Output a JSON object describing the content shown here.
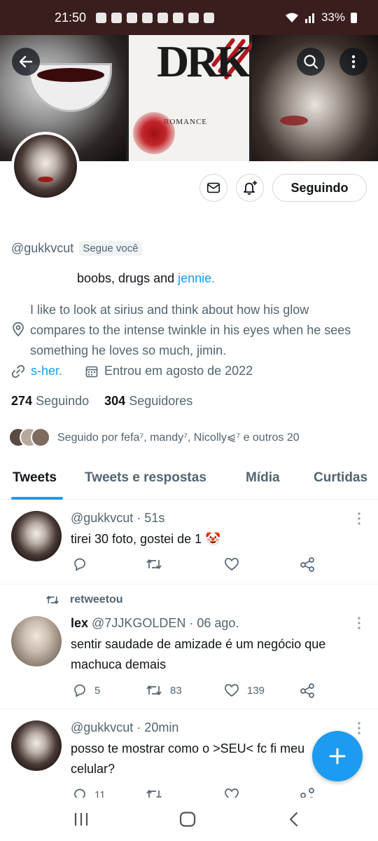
{
  "status_bar": {
    "time": "21:50",
    "battery": "33%"
  },
  "profile": {
    "handle": "@gukkvcut",
    "follows_you": "Segue você",
    "follow_button": "Seguindo",
    "bio_line1_text": "boobs, drugs and ",
    "bio_line1_link": "jennie.",
    "bio_location": "I like to look at sirius and think about how his glow compares to the intense twinkle in his eyes when he sees something he loves so much, jimin.",
    "url": "s-her.",
    "joined": "Entrou em agosto de 2022",
    "following_count": "274",
    "following_label": "Seguindo",
    "followers_count": "304",
    "followers_label": "Seguidores",
    "followed_by": "Seguido por fefa⁷, mandy⁷, Nicolly⩿⁷ e outros 20"
  },
  "banner": {
    "title": "DRK",
    "subtitle": "ROMANCE"
  },
  "tabs": [
    "Tweets",
    "Tweets e respostas",
    "Mídia",
    "Curtidas"
  ],
  "tweets": [
    {
      "header": " @gukkvcut · 51s",
      "text": "tirei 30 foto, gostei de 1 🤡"
    },
    {
      "retweet_label": "retweetou",
      "name": "lex",
      "header": " @7JJKGOLDEN · 06 ago.",
      "text": "sentir saudade de amizade é um negócio que machuca demais",
      "replies": "5",
      "retweets": "83",
      "likes": "139"
    },
    {
      "header": " @gukkvcut · 20min",
      "text": "posso te mostrar como o >SEU< fc fi meu celular?",
      "replies": "11"
    }
  ],
  "colors": {
    "accent": "#1d9bf0",
    "statusbar": "#3a1d1d",
    "muted": "#536471"
  },
  "icons": [
    "back-arrow-icon",
    "search-icon",
    "more-icon",
    "mail-icon",
    "bell-plus-icon",
    "location-icon",
    "link-icon",
    "calendar-icon",
    "reply-icon",
    "retweet-icon",
    "like-icon",
    "share-icon",
    "compose-icon"
  ]
}
